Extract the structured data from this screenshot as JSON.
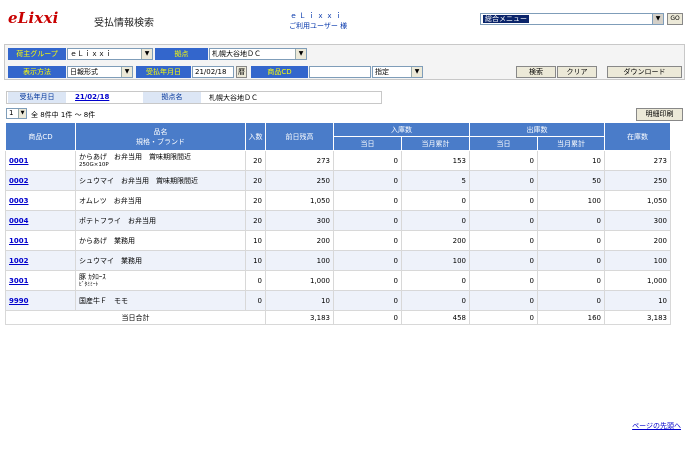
{
  "header": {
    "logo": "eLixxi",
    "page_title": "受払情報検索",
    "company": "ｅＬｉｘｘｉ",
    "user_line": "ご利用ユーザー 様",
    "menu_value": "総合メニュー",
    "go_label": "GO"
  },
  "form": {
    "group_label": "荷主グループ",
    "group_value": "ｅＬｉｘｘｉ",
    "base_label": "拠点",
    "base_value": "札幌大谷地ＤＣ",
    "display_label": "表示方法",
    "display_value": "日報形式",
    "date_label": "受払年月日",
    "date_value": "21/02/18",
    "calendar_label": "暦",
    "product_label": "商品CD",
    "product_value": "",
    "match_value": "指定",
    "search_label": "検索",
    "clear_label": "クリア",
    "download_label": "ダウンロード"
  },
  "info": {
    "date_label": "受払年月日",
    "date_value": "21/02/18",
    "base_label": "拠点名",
    "base_value": "札幌大谷地ＤＣ"
  },
  "pager": {
    "page_value": "1",
    "summary": "全 8件中 1件 ～ 8件"
  },
  "print_label": "明細印刷",
  "table": {
    "headers": {
      "code": "商品CD",
      "name": "品名",
      "spec": "規格・ブランド",
      "qty": "入数",
      "prev": "前日残高",
      "in": "入庫数",
      "out": "出庫数",
      "today": "当日",
      "month": "当月累計",
      "stock": "在庫数"
    },
    "rows": [
      {
        "code": "0001",
        "name": "からあげ　お弁当用　賞味期限間近",
        "spec": "250G×10P",
        "qty": "20",
        "prev": "273",
        "in_day": "0",
        "in_month": "153",
        "out_day": "0",
        "out_month": "10",
        "stock": "273"
      },
      {
        "code": "0002",
        "name": "シュウマイ　お弁当用　賞味期限間近",
        "spec": "",
        "qty": "20",
        "prev": "250",
        "in_day": "0",
        "in_month": "5",
        "out_day": "0",
        "out_month": "50",
        "stock": "250"
      },
      {
        "code": "0003",
        "name": "オムレツ　お弁当用",
        "spec": "",
        "qty": "20",
        "prev": "1,050",
        "in_day": "0",
        "in_month": "0",
        "out_day": "0",
        "out_month": "100",
        "stock": "1,050"
      },
      {
        "code": "0004",
        "name": "ポテトフライ　お弁当用",
        "spec": "",
        "qty": "20",
        "prev": "300",
        "in_day": "0",
        "in_month": "0",
        "out_day": "0",
        "out_month": "0",
        "stock": "300"
      },
      {
        "code": "1001",
        "name": "からあげ　業務用",
        "spec": "",
        "qty": "10",
        "prev": "200",
        "in_day": "0",
        "in_month": "200",
        "out_day": "0",
        "out_month": "0",
        "stock": "200"
      },
      {
        "code": "1002",
        "name": "シュウマイ　業務用",
        "spec": "",
        "qty": "10",
        "prev": "100",
        "in_day": "0",
        "in_month": "100",
        "out_day": "0",
        "out_month": "0",
        "stock": "100"
      },
      {
        "code": "3001",
        "name": "豚 ｶﾀﾛｰｽ",
        "spec": "ﾋﾞﾀﾐﾐｰﾄ",
        "qty": "0",
        "prev": "1,000",
        "in_day": "0",
        "in_month": "0",
        "out_day": "0",
        "out_month": "0",
        "stock": "1,000"
      },
      {
        "code": "9990",
        "name": "国産牛Ｆ　モモ",
        "spec": "",
        "qty": "0",
        "prev": "10",
        "in_day": "0",
        "in_month": "0",
        "out_day": "0",
        "out_month": "0",
        "stock": "10"
      }
    ],
    "total": {
      "label": "当日合計",
      "prev": "3,183",
      "in_day": "0",
      "in_month": "458",
      "out_day": "0",
      "out_month": "160",
      "stock": "3,183"
    }
  },
  "top_link": "ページの先頭へ"
}
